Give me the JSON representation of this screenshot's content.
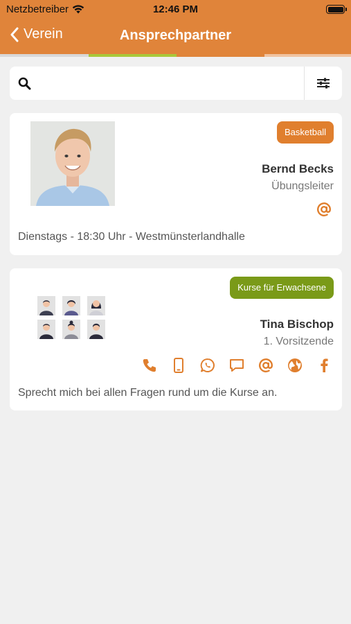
{
  "status": {
    "carrier": "Netzbetreiber",
    "time": "12:46 PM"
  },
  "nav": {
    "back_label": "Verein",
    "title": "Ansprechpartner"
  },
  "search": {
    "placeholder": "",
    "value": ""
  },
  "contacts": [
    {
      "name": "Bernd Becks",
      "role": "Übungsleiter",
      "tag": "Basketball",
      "tag_color": "#e07f2e",
      "description": "Dienstags - 18:30 Uhr - Westmünsterlandhalle",
      "actions": [
        "email-icon"
      ]
    },
    {
      "name": "Tina Bischop",
      "role": "1. Vorsitzende",
      "tag": "Kurse für Erwachsene",
      "tag_color": "#7a9a18",
      "description": "Sprecht mich bei allen Fragen rund um die Kurse an.",
      "actions": [
        "phone-icon",
        "mobile-icon",
        "whatsapp-icon",
        "chat-icon",
        "email-icon",
        "globe-icon",
        "facebook-icon"
      ]
    }
  ],
  "colors": {
    "accent": "#e0843a",
    "icon": "#e07f2e",
    "background": "#f0f0f0"
  }
}
